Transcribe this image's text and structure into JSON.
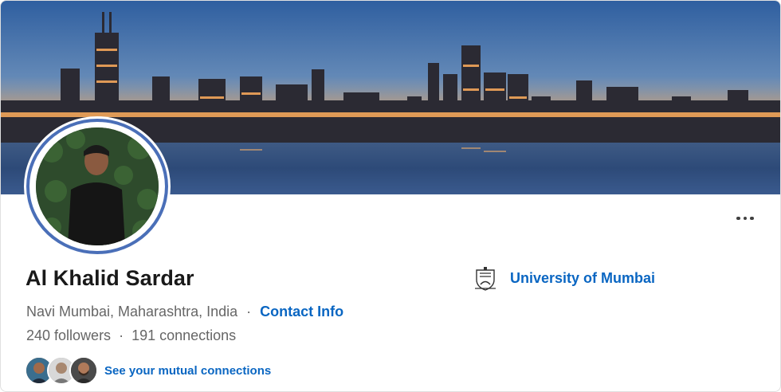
{
  "profile": {
    "name": "Al Khalid Sardar",
    "location": "Navi Mumbai, Maharashtra, India",
    "separator": "·",
    "contact_info_label": "Contact Info",
    "followers": "240 followers",
    "connections": "191 connections",
    "mutual_connections_label": "See your mutual connections",
    "education": "University of Mumbai"
  },
  "colors": {
    "link_blue": "#0a66c2",
    "avatar_ring": "#4a6fb8",
    "text_primary": "#191919",
    "text_secondary": "#666666"
  },
  "icons": {
    "more": "more-horizontal-icon",
    "university": "university-crest-icon"
  }
}
